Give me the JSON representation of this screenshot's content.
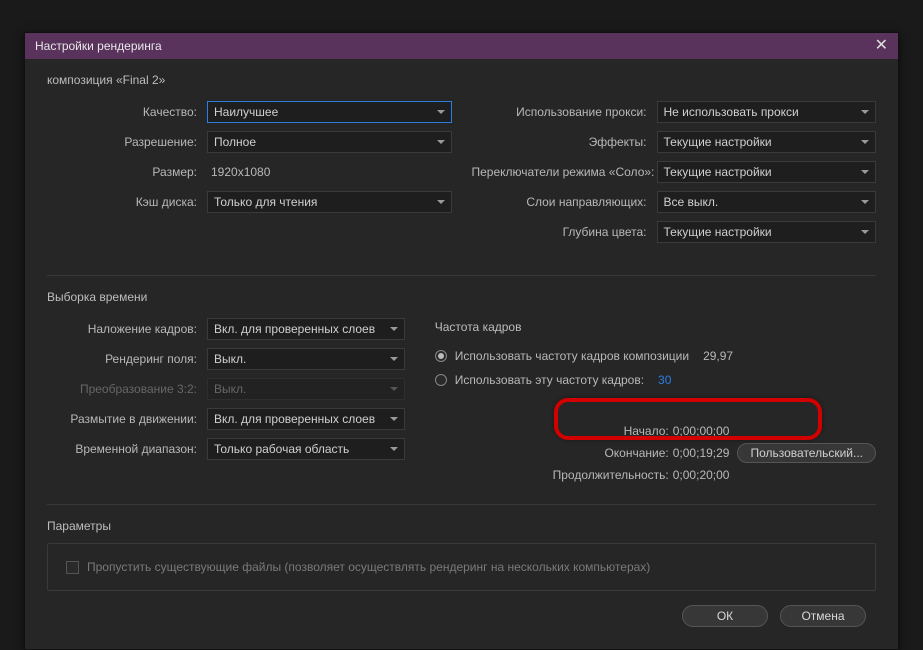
{
  "title": "Настройки рендеринга",
  "composition_label": "композиция «Final 2»",
  "left": {
    "quality_label": "Качество:",
    "quality_value": "Наилучшее",
    "resolution_label": "Разрешение:",
    "resolution_value": "Полное",
    "size_label": "Размер:",
    "size_value": "1920x1080",
    "cache_label": "Кэш диска:",
    "cache_value": "Только для чтения"
  },
  "right": {
    "proxy_label": "Использование прокси:",
    "proxy_value": "Не использовать прокси",
    "effects_label": "Эффекты:",
    "effects_value": "Текущие настройки",
    "solo_label": "Переключатели режима «Соло»:",
    "solo_value": "Текущие настройки",
    "guides_label": "Слои направляющих:",
    "guides_value": "Все выкл.",
    "depth_label": "Глубина цвета:",
    "depth_value": "Текущие настройки"
  },
  "time_section_title": "Выборка времени",
  "time_left": {
    "blend_label": "Наложение кадров:",
    "blend_value": "Вкл. для проверенных слоев",
    "field_label": "Рендеринг поля:",
    "field_value": "Выкл.",
    "pulldown_label": "Преобразование 3:2:",
    "pulldown_value": "Выкл.",
    "motion_label": "Размытие в движении:",
    "motion_value": "Вкл. для проверенных слоев",
    "span_label": "Временной диапазон:",
    "span_value": "Только рабочая область"
  },
  "framerate": {
    "title": "Частота кадров",
    "comp_label": "Использовать частоту кадров композиции",
    "comp_value": "29,97",
    "this_label": "Использовать эту частоту кадров:",
    "this_value": "30"
  },
  "timing": {
    "start_label": "Начало:",
    "start_value": "0;00;00;00",
    "end_label": "Окончание:",
    "end_value": "0;00;19;29",
    "custom_btn": "Пользовательский...",
    "duration_label": "Продолжительность:",
    "duration_value": "0;00;20;00"
  },
  "params": {
    "title": "Параметры",
    "skip_label": "Пропустить существующие файлы (позволяет осуществлять рендеринг на нескольких компьютерах)"
  },
  "buttons": {
    "ok": "ОК",
    "cancel": "Отмена"
  }
}
